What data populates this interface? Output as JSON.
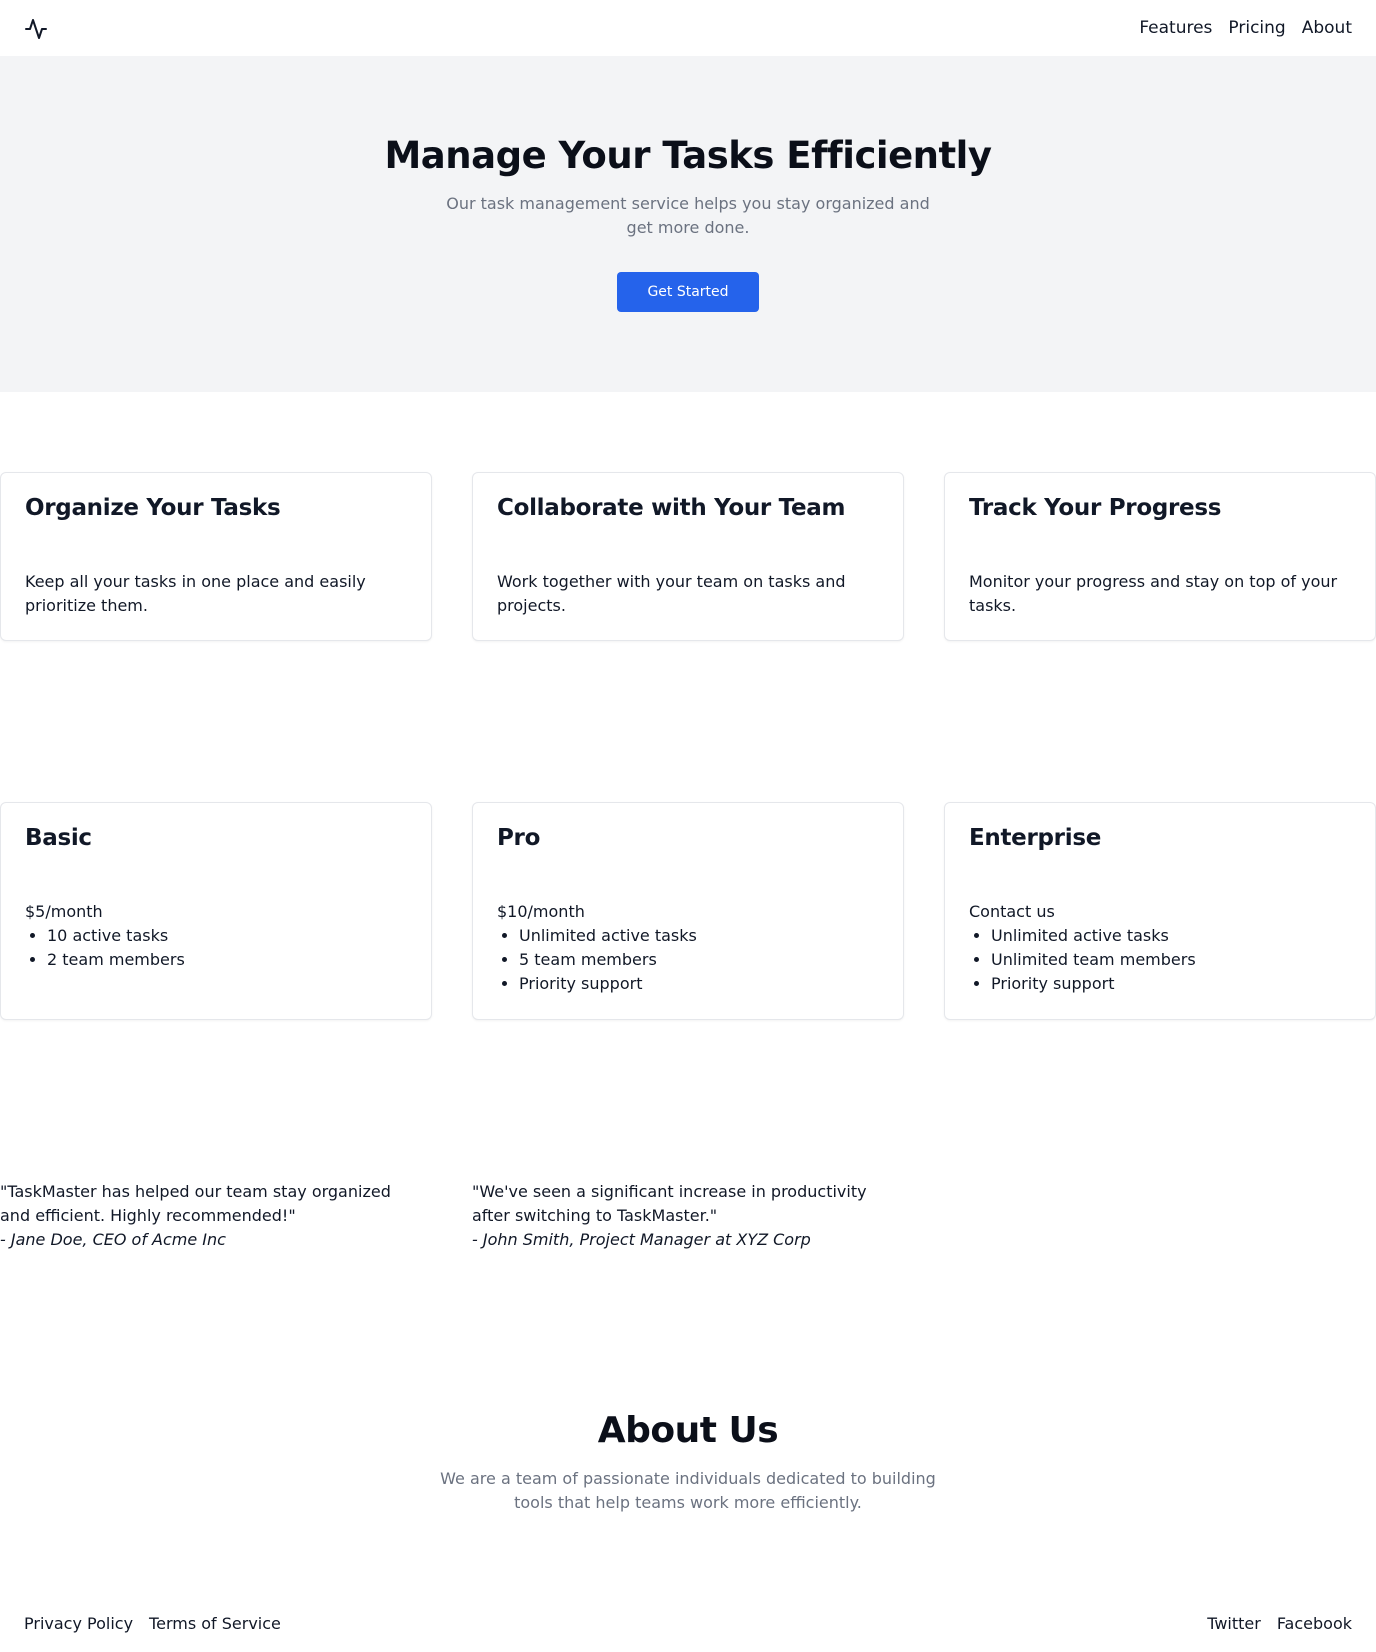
{
  "header": {
    "logo_icon": "activity-pulse-icon",
    "nav": [
      "Features",
      "Pricing",
      "About"
    ]
  },
  "hero": {
    "title": "Manage Your Tasks Efficiently",
    "subtitle": "Our task management service helps you stay organized and get more done.",
    "cta_label": "Get Started"
  },
  "features": [
    {
      "title": "Organize Your Tasks",
      "description": "Keep all your tasks in one place and easily prioritize them."
    },
    {
      "title": "Collaborate with Your Team",
      "description": "Work together with your team on tasks and projects."
    },
    {
      "title": "Track Your Progress",
      "description": "Monitor your progress and stay on top of your tasks."
    }
  ],
  "pricing": [
    {
      "name": "Basic",
      "price": "$5/month",
      "features": [
        "10 active tasks",
        "2 team members"
      ]
    },
    {
      "name": "Pro",
      "price": "$10/month",
      "features": [
        "Unlimited active tasks",
        "5 team members",
        "Priority support"
      ]
    },
    {
      "name": "Enterprise",
      "price": "Contact us",
      "features": [
        "Unlimited active tasks",
        "Unlimited team members",
        "Priority support"
      ]
    }
  ],
  "testimonials": [
    {
      "quote": "\"TaskMaster has helped our team stay organized and efficient. Highly recommended!\"",
      "author": "- Jane Doe, CEO of Acme Inc"
    },
    {
      "quote": "\"We've seen a significant increase in productivity after switching to TaskMaster.\"",
      "author": "- John Smith, Project Manager at XYZ Corp"
    }
  ],
  "about": {
    "title": "About Us",
    "text": "We are a team of passionate individuals dedicated to building tools that help teams work more efficiently."
  },
  "footer": {
    "left_links": [
      "Privacy Policy",
      "Terms of Service"
    ],
    "right_links": [
      "Twitter",
      "Facebook"
    ]
  },
  "colors": {
    "accent": "#2563eb",
    "hero_bg": "#f3f4f6",
    "muted_text": "#6b7280"
  }
}
